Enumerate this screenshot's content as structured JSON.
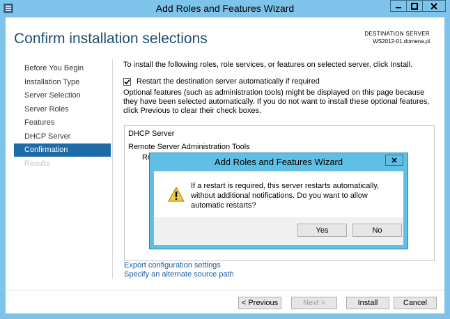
{
  "window": {
    "title": "Add Roles and Features Wizard"
  },
  "page": {
    "heading": "Confirm installation selections",
    "destination_label": "DESTINATION SERVER",
    "destination_value": "WS2012-01.domena.pl"
  },
  "nav": {
    "items": [
      {
        "label": "Before You Begin",
        "state": "normal"
      },
      {
        "label": "Installation Type",
        "state": "normal"
      },
      {
        "label": "Server Selection",
        "state": "normal"
      },
      {
        "label": "Server Roles",
        "state": "normal"
      },
      {
        "label": "Features",
        "state": "normal"
      },
      {
        "label": "DHCP Server",
        "state": "normal"
      },
      {
        "label": "Confirmation",
        "state": "active"
      },
      {
        "label": "Results",
        "state": "disabled"
      }
    ]
  },
  "main": {
    "intro": "To install the following roles, role services, or features on selected server, click Install.",
    "restart_checkbox": {
      "label": "Restart the destination server automatically if required",
      "checked": true
    },
    "optional_text": "Optional features (such as administration tools) might be displayed on this page because they have been selected automatically. If you do not want to install these optional features, click Previous to clear their check boxes.",
    "list": [
      "DHCP Server",
      "Remote Server Administration Tools",
      "Ro"
    ],
    "links": {
      "export": "Export configuration settings",
      "alternate_source": "Specify an alternate source path"
    }
  },
  "buttons": {
    "previous": "< Previous",
    "next": "Next >",
    "install": "Install",
    "cancel": "Cancel"
  },
  "dialog": {
    "title": "Add Roles and Features Wizard",
    "message": "If a restart is required, this server restarts automatically, without additional notifications. Do you want to allow automatic restarts?",
    "yes": "Yes",
    "no": "No",
    "icon": "warning-icon"
  },
  "colors": {
    "titlebar": "#7ec3ea",
    "accent": "#1e6ba8",
    "heading": "#1e4f70",
    "dialog_frame": "#5fbfe4"
  }
}
